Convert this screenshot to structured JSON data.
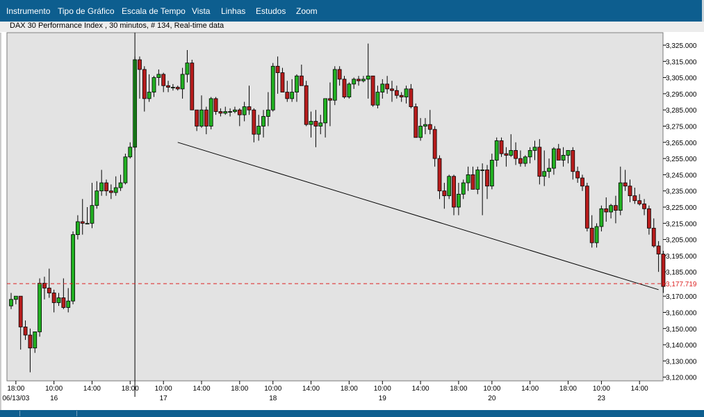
{
  "menu": {
    "items": [
      "Instrumento",
      "Tipo de Gráfico",
      "Escala de Tempo",
      "Vista",
      "Linhas",
      "Estudos",
      "Zoom"
    ]
  },
  "chart_title": "DAX 30 Performance Index , 30 minutos, # 134, Real-time data",
  "colors": {
    "up": "#22b022",
    "down": "#b71c1c",
    "plot_bg": "#e3e3e3",
    "current_price": "#dd2222",
    "menubar": "#0d5e8f"
  },
  "chart_data": {
    "type": "candlestick",
    "instrument": "DAX 30 Performance Index",
    "interval": "30 minutos",
    "ylim": [
      3115,
      3335
    ],
    "y_ticks": [
      "3,120.000",
      "3,130.000",
      "3,140.000",
      "3,150.000",
      "3,160.000",
      "3,170.000",
      "3,185.000",
      "3,195.000",
      "3,205.000",
      "3,215.000",
      "3,225.000",
      "3,235.000",
      "3,245.000",
      "3,255.000",
      "3,265.000",
      "3,275.000",
      "3,285.000",
      "3,295.000",
      "3,305.000",
      "3,315.000",
      "3,325.000"
    ],
    "current_price_label": "3,177.719",
    "current_price": 3177.719,
    "x_labels": [
      {
        "bar": 1,
        "time": "18:00",
        "day": "06/13/03"
      },
      {
        "bar": 9,
        "time": "10:00",
        "day": "16"
      },
      {
        "bar": 17,
        "time": "14:00"
      },
      {
        "bar": 25,
        "time": "18:00"
      },
      {
        "bar": 32,
        "time": "10:00",
        "day": "17"
      },
      {
        "bar": 40,
        "time": "14:00"
      },
      {
        "bar": 48,
        "time": "18:00"
      },
      {
        "bar": 55,
        "time": "10:00",
        "day": "18"
      },
      {
        "bar": 63,
        "time": "14:00"
      },
      {
        "bar": 71,
        "time": "18:00"
      },
      {
        "bar": 78,
        "time": "10:00",
        "day": "19"
      },
      {
        "bar": 86,
        "time": "14:00"
      },
      {
        "bar": 94,
        "time": "18:00"
      },
      {
        "bar": 101,
        "time": "10:00",
        "day": "20"
      },
      {
        "bar": 109,
        "time": "14:00"
      },
      {
        "bar": 117,
        "time": "18:00"
      },
      {
        "bar": 124,
        "time": "10:00",
        "day": "23"
      },
      {
        "bar": 132,
        "time": "14:00"
      }
    ],
    "candles": [
      [
        3164,
        3172,
        3162,
        3168
      ],
      [
        3168,
        3170,
        3165,
        3170
      ],
      [
        3170,
        3170,
        3137,
        3151
      ],
      [
        3151,
        3155,
        3143,
        3146
      ],
      [
        3146,
        3150,
        3123,
        3138
      ],
      [
        3138,
        3147,
        3135,
        3148
      ],
      [
        3148,
        3181,
        3145,
        3178
      ],
      [
        3178,
        3182,
        3168,
        3175
      ],
      [
        3175,
        3187,
        3169,
        3172
      ],
      [
        3172,
        3174,
        3160,
        3166
      ],
      [
        3166,
        3172,
        3164,
        3169
      ],
      [
        3169,
        3181,
        3162,
        3163
      ],
      [
        3163,
        3175,
        3160,
        3167
      ],
      [
        3167,
        3210,
        3165,
        3208
      ],
      [
        3208,
        3220,
        3205,
        3216
      ],
      [
        3216,
        3230,
        3208,
        3215
      ],
      [
        3215,
        3225,
        3215,
        3215
      ],
      [
        3215,
        3240,
        3212,
        3226
      ],
      [
        3226,
        3241,
        3224,
        3235
      ],
      [
        3235,
        3248,
        3232,
        3240
      ],
      [
        3240,
        3242,
        3232,
        3235
      ],
      [
        3235,
        3239,
        3230,
        3234
      ],
      [
        3234,
        3244,
        3232,
        3237
      ],
      [
        3237,
        3245,
        3235,
        3240
      ],
      [
        3240,
        3258,
        3239,
        3256
      ],
      [
        3256,
        3265,
        3255,
        3262
      ],
      [
        3262,
        3318,
        3260,
        3316
      ],
      [
        3316,
        3318,
        3292,
        3310
      ],
      [
        3310,
        3312,
        3284,
        3292
      ],
      [
        3292,
        3307,
        3290,
        3296
      ],
      [
        3296,
        3306,
        3293,
        3305
      ],
      [
        3305,
        3310,
        3300,
        3307
      ],
      [
        3307,
        3308,
        3296,
        3300
      ],
      [
        3300,
        3303,
        3296,
        3299
      ],
      [
        3299,
        3301,
        3297,
        3299
      ],
      [
        3299,
        3300,
        3297,
        3298
      ],
      [
        3298,
        3311,
        3292,
        3307
      ],
      [
        3307,
        3322,
        3302,
        3314
      ],
      [
        3314,
        3316,
        3288,
        3285
      ],
      [
        3285,
        3285,
        3272,
        3275
      ],
      [
        3275,
        3294,
        3274,
        3285
      ],
      [
        3285,
        3287,
        3270,
        3275
      ],
      [
        3275,
        3293,
        3273,
        3292
      ],
      [
        3292,
        3293,
        3282,
        3284
      ],
      [
        3284,
        3286,
        3281,
        3283
      ],
      [
        3283,
        3287,
        3282,
        3284
      ],
      [
        3284,
        3286,
        3281,
        3284
      ],
      [
        3284,
        3287,
        3283,
        3285
      ],
      [
        3285,
        3286,
        3275,
        3282
      ],
      [
        3282,
        3290,
        3278,
        3287
      ],
      [
        3287,
        3300,
        3282,
        3285
      ],
      [
        3285,
        3286,
        3265,
        3270
      ],
      [
        3270,
        3282,
        3266,
        3275
      ],
      [
        3275,
        3285,
        3268,
        3281
      ],
      [
        3281,
        3296,
        3275,
        3285
      ],
      [
        3285,
        3314,
        3284,
        3312
      ],
      [
        3312,
        3318,
        3295,
        3308
      ],
      [
        3308,
        3311,
        3296,
        3296
      ],
      [
        3296,
        3303,
        3290,
        3292
      ],
      [
        3292,
        3304,
        3290,
        3296
      ],
      [
        3296,
        3307,
        3290,
        3306
      ],
      [
        3306,
        3313,
        3300,
        3300
      ],
      [
        3300,
        3303,
        3275,
        3276
      ],
      [
        3276,
        3284,
        3268,
        3278
      ],
      [
        3278,
        3285,
        3262,
        3275
      ],
      [
        3275,
        3282,
        3270,
        3277
      ],
      [
        3277,
        3289,
        3268,
        3292
      ],
      [
        3292,
        3302,
        3275,
        3291
      ],
      [
        3291,
        3312,
        3288,
        3310
      ],
      [
        3310,
        3312,
        3300,
        3304
      ],
      [
        3304,
        3306,
        3292,
        3293
      ],
      [
        3293,
        3302,
        3292,
        3301
      ],
      [
        3301,
        3305,
        3298,
        3304
      ],
      [
        3304,
        3306,
        3300,
        3303
      ],
      [
        3303,
        3306,
        3302,
        3304
      ],
      [
        3304,
        3326,
        3292,
        3306
      ],
      [
        3306,
        3306,
        3287,
        3288
      ],
      [
        3288,
        3300,
        3286,
        3296
      ],
      [
        3296,
        3304,
        3292,
        3301
      ],
      [
        3301,
        3306,
        3295,
        3298
      ],
      [
        3298,
        3303,
        3290,
        3297
      ],
      [
        3297,
        3300,
        3292,
        3294
      ],
      [
        3294,
        3296,
        3290,
        3293
      ],
      [
        3293,
        3300,
        3289,
        3298
      ],
      [
        3298,
        3301,
        3286,
        3287
      ],
      [
        3287,
        3289,
        3268,
        3268
      ],
      [
        3268,
        3280,
        3266,
        3275
      ],
      [
        3275,
        3280,
        3270,
        3276
      ],
      [
        3276,
        3285,
        3270,
        3273
      ],
      [
        3273,
        3275,
        3250,
        3255
      ],
      [
        3255,
        3257,
        3230,
        3235
      ],
      [
        3235,
        3240,
        3224,
        3232
      ],
      [
        3232,
        3245,
        3230,
        3244
      ],
      [
        3244,
        3245,
        3220,
        3225
      ],
      [
        3225,
        3240,
        3220,
        3233
      ],
      [
        3233,
        3242,
        3230,
        3240
      ],
      [
        3240,
        3250,
        3235,
        3245
      ],
      [
        3245,
        3250,
        3242,
        3236
      ],
      [
        3236,
        3250,
        3233,
        3248
      ],
      [
        3248,
        3252,
        3220,
        3248
      ],
      [
        3248,
        3251,
        3230,
        3238
      ],
      [
        3238,
        3258,
        3236,
        3254
      ],
      [
        3254,
        3268,
        3250,
        3266
      ],
      [
        3266,
        3268,
        3256,
        3258
      ],
      [
        3258,
        3262,
        3250,
        3257
      ],
      [
        3257,
        3270,
        3256,
        3260
      ],
      [
        3260,
        3265,
        3251,
        3255
      ],
      [
        3255,
        3260,
        3250,
        3252
      ],
      [
        3252,
        3257,
        3250,
        3256
      ],
      [
        3256,
        3262,
        3252,
        3260
      ],
      [
        3260,
        3266,
        3254,
        3262
      ],
      [
        3262,
        3267,
        3239,
        3244
      ],
      [
        3244,
        3260,
        3238,
        3247
      ],
      [
        3247,
        3255,
        3243,
        3249
      ],
      [
        3249,
        3262,
        3245,
        3261
      ],
      [
        3261,
        3264,
        3256,
        3254
      ],
      [
        3254,
        3262,
        3250,
        3257
      ],
      [
        3257,
        3260,
        3252,
        3260
      ],
      [
        3260,
        3262,
        3242,
        3247
      ],
      [
        3247,
        3250,
        3240,
        3243
      ],
      [
        3243,
        3245,
        3235,
        3238
      ],
      [
        3238,
        3240,
        3210,
        3212
      ],
      [
        3212,
        3220,
        3200,
        3203
      ],
      [
        3203,
        3215,
        3200,
        3213
      ],
      [
        3213,
        3226,
        3210,
        3224
      ],
      [
        3224,
        3231,
        3216,
        3222
      ],
      [
        3222,
        3227,
        3218,
        3226
      ],
      [
        3226,
        3232,
        3215,
        3223
      ],
      [
        3223,
        3250,
        3220,
        3240
      ],
      [
        3240,
        3248,
        3235,
        3238
      ],
      [
        3238,
        3242,
        3228,
        3232
      ],
      [
        3232,
        3237,
        3227,
        3229
      ],
      [
        3229,
        3233,
        3226,
        3227
      ],
      [
        3227,
        3230,
        3220,
        3224
      ],
      [
        3224,
        3226,
        3208,
        3212
      ],
      [
        3212,
        3218,
        3200,
        3201
      ],
      [
        3201,
        3204,
        3185,
        3196
      ],
      [
        3196,
        3198,
        3172,
        3176
      ]
    ],
    "trend_line": {
      "from": [
        35,
        3265
      ],
      "to": [
        136,
        3174
      ]
    },
    "cursor_line_bar": 26
  }
}
